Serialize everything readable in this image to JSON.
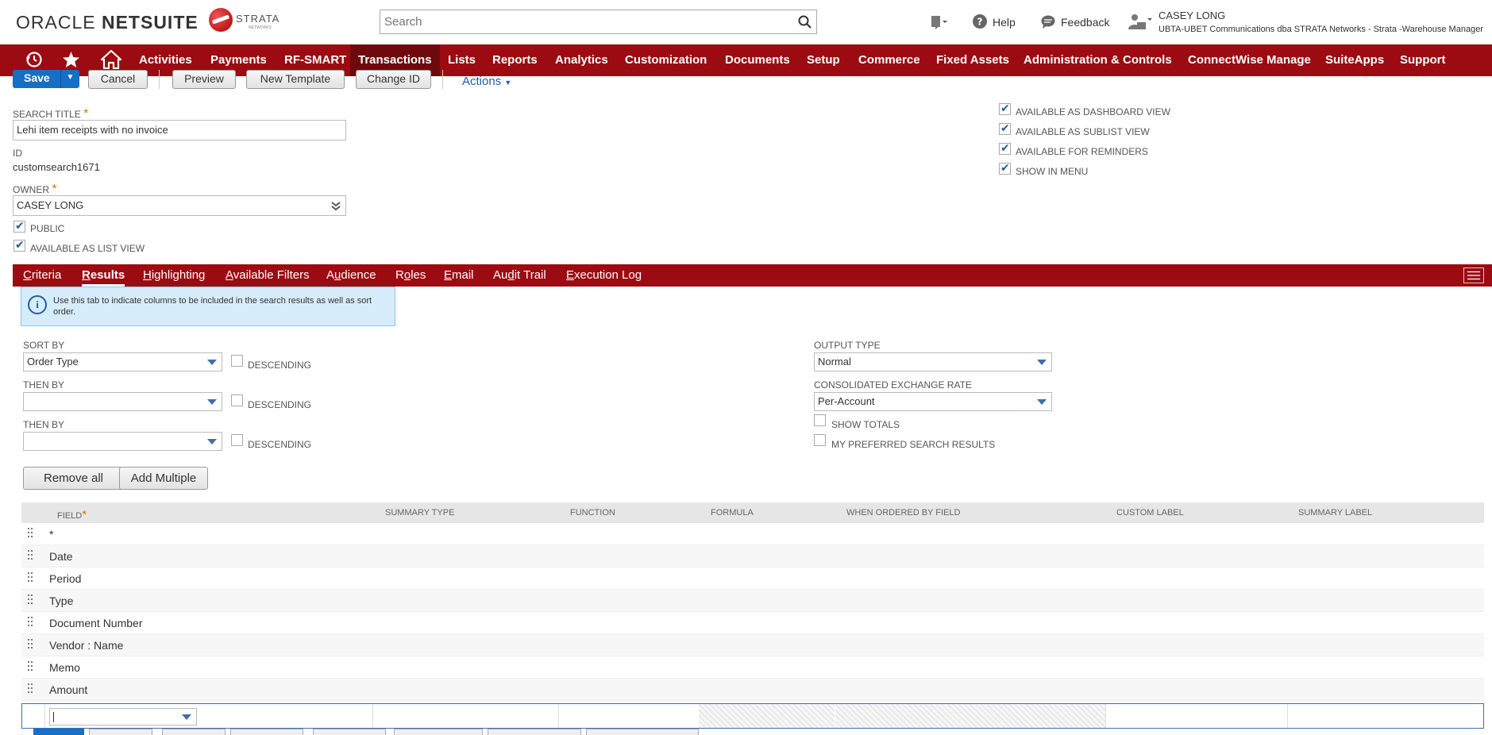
{
  "header": {
    "brand": {
      "oracle": "ORACLE",
      "netsuite": "NETSUITE"
    },
    "company_logo": {
      "name": "STRATA",
      "subtitle": "NETWORKS"
    },
    "search_placeholder": "Search",
    "help_label": "Help",
    "feedback_label": "Feedback",
    "user_name": "CASEY LONG",
    "user_role": "UBTA-UBET Communications dba STRATA Networks - Strata -Warehouse Manager"
  },
  "nav": {
    "items": [
      "Activities",
      "Payments",
      "RF-SMART",
      "Transactions",
      "Lists",
      "Reports",
      "Analytics",
      "Customization",
      "Documents",
      "Setup",
      "Commerce",
      "Fixed Assets",
      "Administration & Controls",
      "ConnectWise Manage",
      "SuiteApps",
      "Support"
    ],
    "active": "Transactions"
  },
  "toolbar": {
    "save": "Save",
    "cancel": "Cancel",
    "preview": "Preview",
    "new_template": "New Template",
    "change_id": "Change ID",
    "actions": "Actions"
  },
  "form": {
    "search_title_label": "SEARCH TITLE",
    "search_title_value": "Lehi item receipts with no invoice",
    "id_label": "ID",
    "id_value": "customsearch1671",
    "owner_label": "OWNER",
    "owner_value": "CASEY LONG",
    "public_label": "PUBLIC",
    "public_checked": true,
    "list_view_label": "AVAILABLE AS LIST VIEW",
    "list_view_checked": true,
    "right_checkboxes": [
      {
        "label": "AVAILABLE AS DASHBOARD VIEW",
        "checked": true
      },
      {
        "label": "AVAILABLE AS SUBLIST VIEW",
        "checked": true
      },
      {
        "label": "AVAILABLE FOR REMINDERS",
        "checked": true
      },
      {
        "label": "SHOW IN MENU",
        "checked": true
      }
    ]
  },
  "tabs": {
    "items": [
      "Criteria",
      "Results",
      "Highlighting",
      "Available Filters",
      "Audience",
      "Roles",
      "Email",
      "Audit Trail",
      "Execution Log"
    ],
    "active": "Results"
  },
  "results": {
    "info": "Use this tab to indicate columns to be included in the search results as well as sort order.",
    "sort_by_label": "SORT BY",
    "sort_by_value": "Order Type",
    "then_by_label": "THEN BY",
    "then_by_1_value": "",
    "then_by_2_value": "",
    "descending_label": "DESCENDING",
    "output_type_label": "OUTPUT TYPE",
    "output_type_value": "Normal",
    "exchange_rate_label": "CONSOLIDATED EXCHANGE RATE",
    "exchange_rate_value": "Per-Account",
    "show_totals_label": "SHOW TOTALS",
    "preferred_label": "MY PREFERRED SEARCH RESULTS",
    "remove_all": "Remove all",
    "add_multiple": "Add Multiple",
    "columns": [
      "FIELD",
      "SUMMARY TYPE",
      "FUNCTION",
      "FORMULA",
      "WHEN ORDERED BY FIELD",
      "CUSTOM LABEL",
      "SUMMARY LABEL"
    ],
    "rows": [
      "*",
      "Date",
      "Period",
      "Type",
      "Document Number",
      "Vendor : Name",
      "Memo",
      "Amount"
    ]
  }
}
